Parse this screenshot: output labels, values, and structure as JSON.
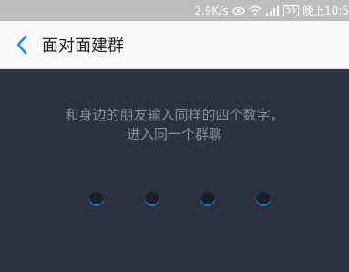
{
  "status_bar": {
    "network_speed": "2.9K/s",
    "battery": "55",
    "time": "晚上10:5"
  },
  "nav": {
    "title": "面对面建群"
  },
  "instruction": {
    "line1": "和身边的朋友输入同样的四个数字，",
    "line2": "进入同一个群聊"
  },
  "digits": [
    "",
    "",
    "",
    ""
  ],
  "colors": {
    "background": "#2d3240",
    "accent": "#1f7fc0",
    "status_bar": "#bdbdbd"
  }
}
